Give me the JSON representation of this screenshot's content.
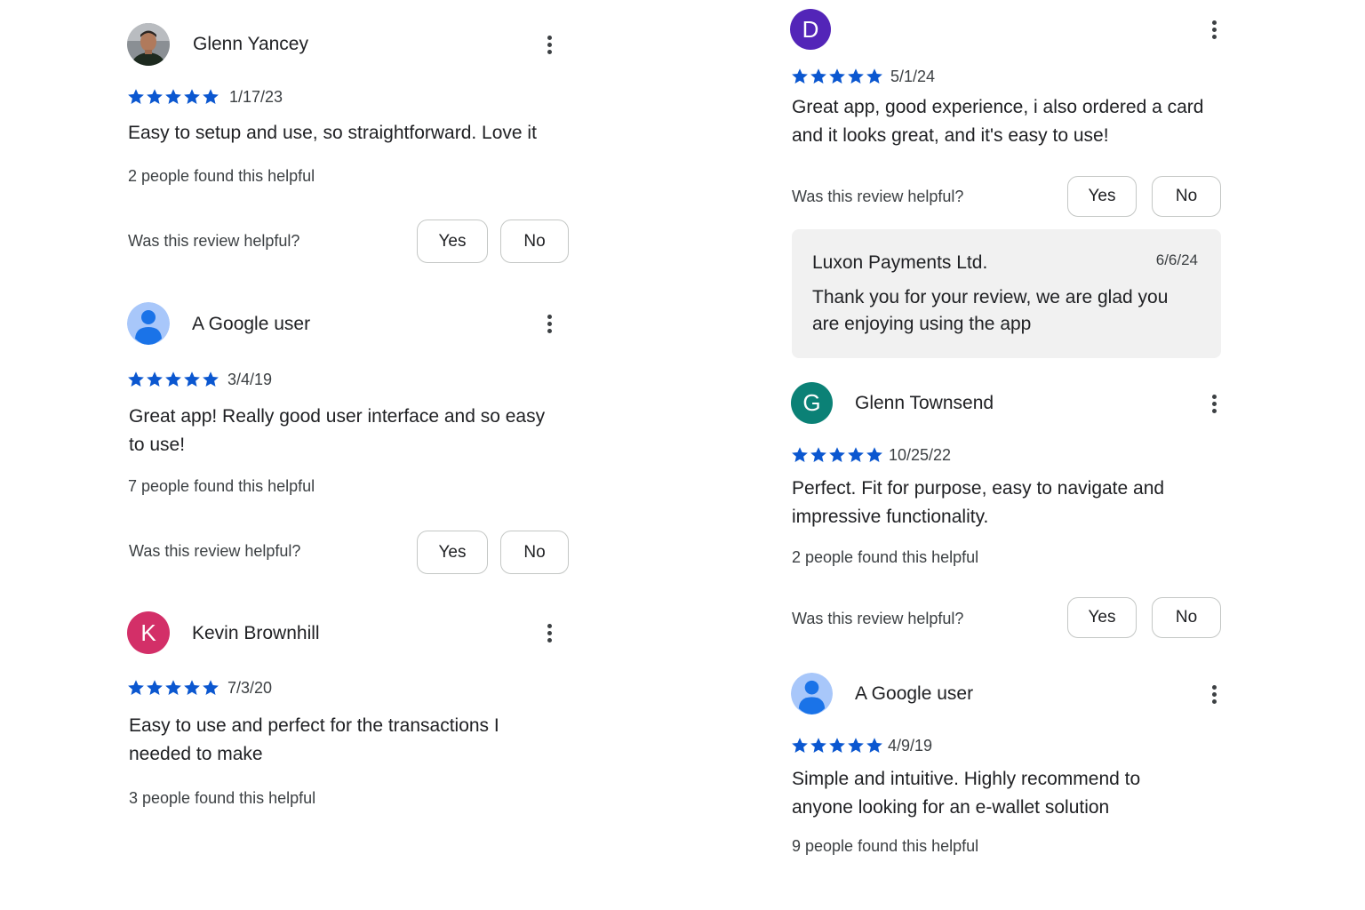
{
  "colors": {
    "star": "#0b57d0",
    "avatar_purple": "#5325b8",
    "avatar_teal": "#0b8176",
    "avatar_pink": "#d32f68",
    "google_user_bg": "#a8c7fa",
    "google_user_fg": "#1a73e8"
  },
  "left_column": {
    "reviews": [
      {
        "name": "Glenn Yancey",
        "avatar_icon": "profile-photo",
        "rating": 5,
        "date": "1/17/23",
        "text": "Easy to setup and use, so straightforward. Love it",
        "helpful_count_text": "2 people found this helpful",
        "helpful_question": "Was this review helpful?",
        "yes_label": "Yes",
        "no_label": "No"
      },
      {
        "name": "A Google user",
        "avatar_icon": "person-icon",
        "rating": 5,
        "date": "3/4/19",
        "text": "Great app! Really good user interface and so easy to use!",
        "helpful_count_text": "7 people found this helpful",
        "helpful_question": "Was this review helpful?",
        "yes_label": "Yes",
        "no_label": "No"
      },
      {
        "name": "Kevin Brownhill",
        "avatar_letter": "K",
        "rating": 5,
        "date": "7/3/20",
        "text": "Easy to use and perfect for the transactions I needed to make",
        "helpful_count_text": "3 people found this helpful"
      }
    ]
  },
  "right_column": {
    "reviews": [
      {
        "avatar_letter": "D",
        "rating": 5,
        "date": "5/1/24",
        "text": "Great app, good experience, i also ordered a card and it looks great, and it's easy to use!",
        "helpful_question": "Was this review helpful?",
        "yes_label": "Yes",
        "no_label": "No",
        "developer_reply": {
          "name": "Luxon Payments Ltd.",
          "date": "6/6/24",
          "text": "Thank you for your review, we are glad you are enjoying using the app"
        }
      },
      {
        "name": "Glenn Townsend",
        "avatar_letter": "G",
        "rating": 5,
        "date": "10/25/22",
        "text": "Perfect. Fit for purpose, easy to navigate and impressive functionality.",
        "helpful_count_text": "2 people found this helpful",
        "helpful_question": "Was this review helpful?",
        "yes_label": "Yes",
        "no_label": "No"
      },
      {
        "name": "A Google user",
        "avatar_icon": "person-icon",
        "rating": 5,
        "date": "4/9/19",
        "text": "Simple and intuitive. Highly recommend to anyone looking for an e-wallet solution",
        "helpful_count_text": "9 people found this helpful"
      }
    ]
  }
}
